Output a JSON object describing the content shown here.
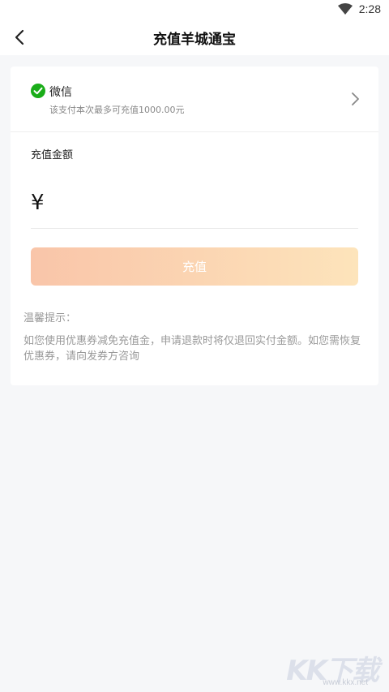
{
  "status_bar": {
    "time": "2:28",
    "icon": "wifi-icon"
  },
  "nav": {
    "title": "充值羊城通宝",
    "back_icon": "chevron-left-icon"
  },
  "payment": {
    "method": "微信",
    "limit_text": "该支付本次最多可充值1000.00元",
    "icon": "wechat-check-icon",
    "icon_color": "#1aad19"
  },
  "amount": {
    "label": "充值金额",
    "currency": "¥",
    "value": "",
    "placeholder": ""
  },
  "recharge_button": {
    "label": "充值",
    "gradient_start": "#f9c5a9",
    "gradient_end": "#fde4bb"
  },
  "tips": {
    "title": "温馨提示：",
    "body": "如您使用优惠券减免充值金，申请退款时将仅退回实付金额。如您需恢复优惠券，请向发券方咨询"
  },
  "watermark": {
    "brand": "KK下载",
    "url": "www.kkx.net"
  }
}
